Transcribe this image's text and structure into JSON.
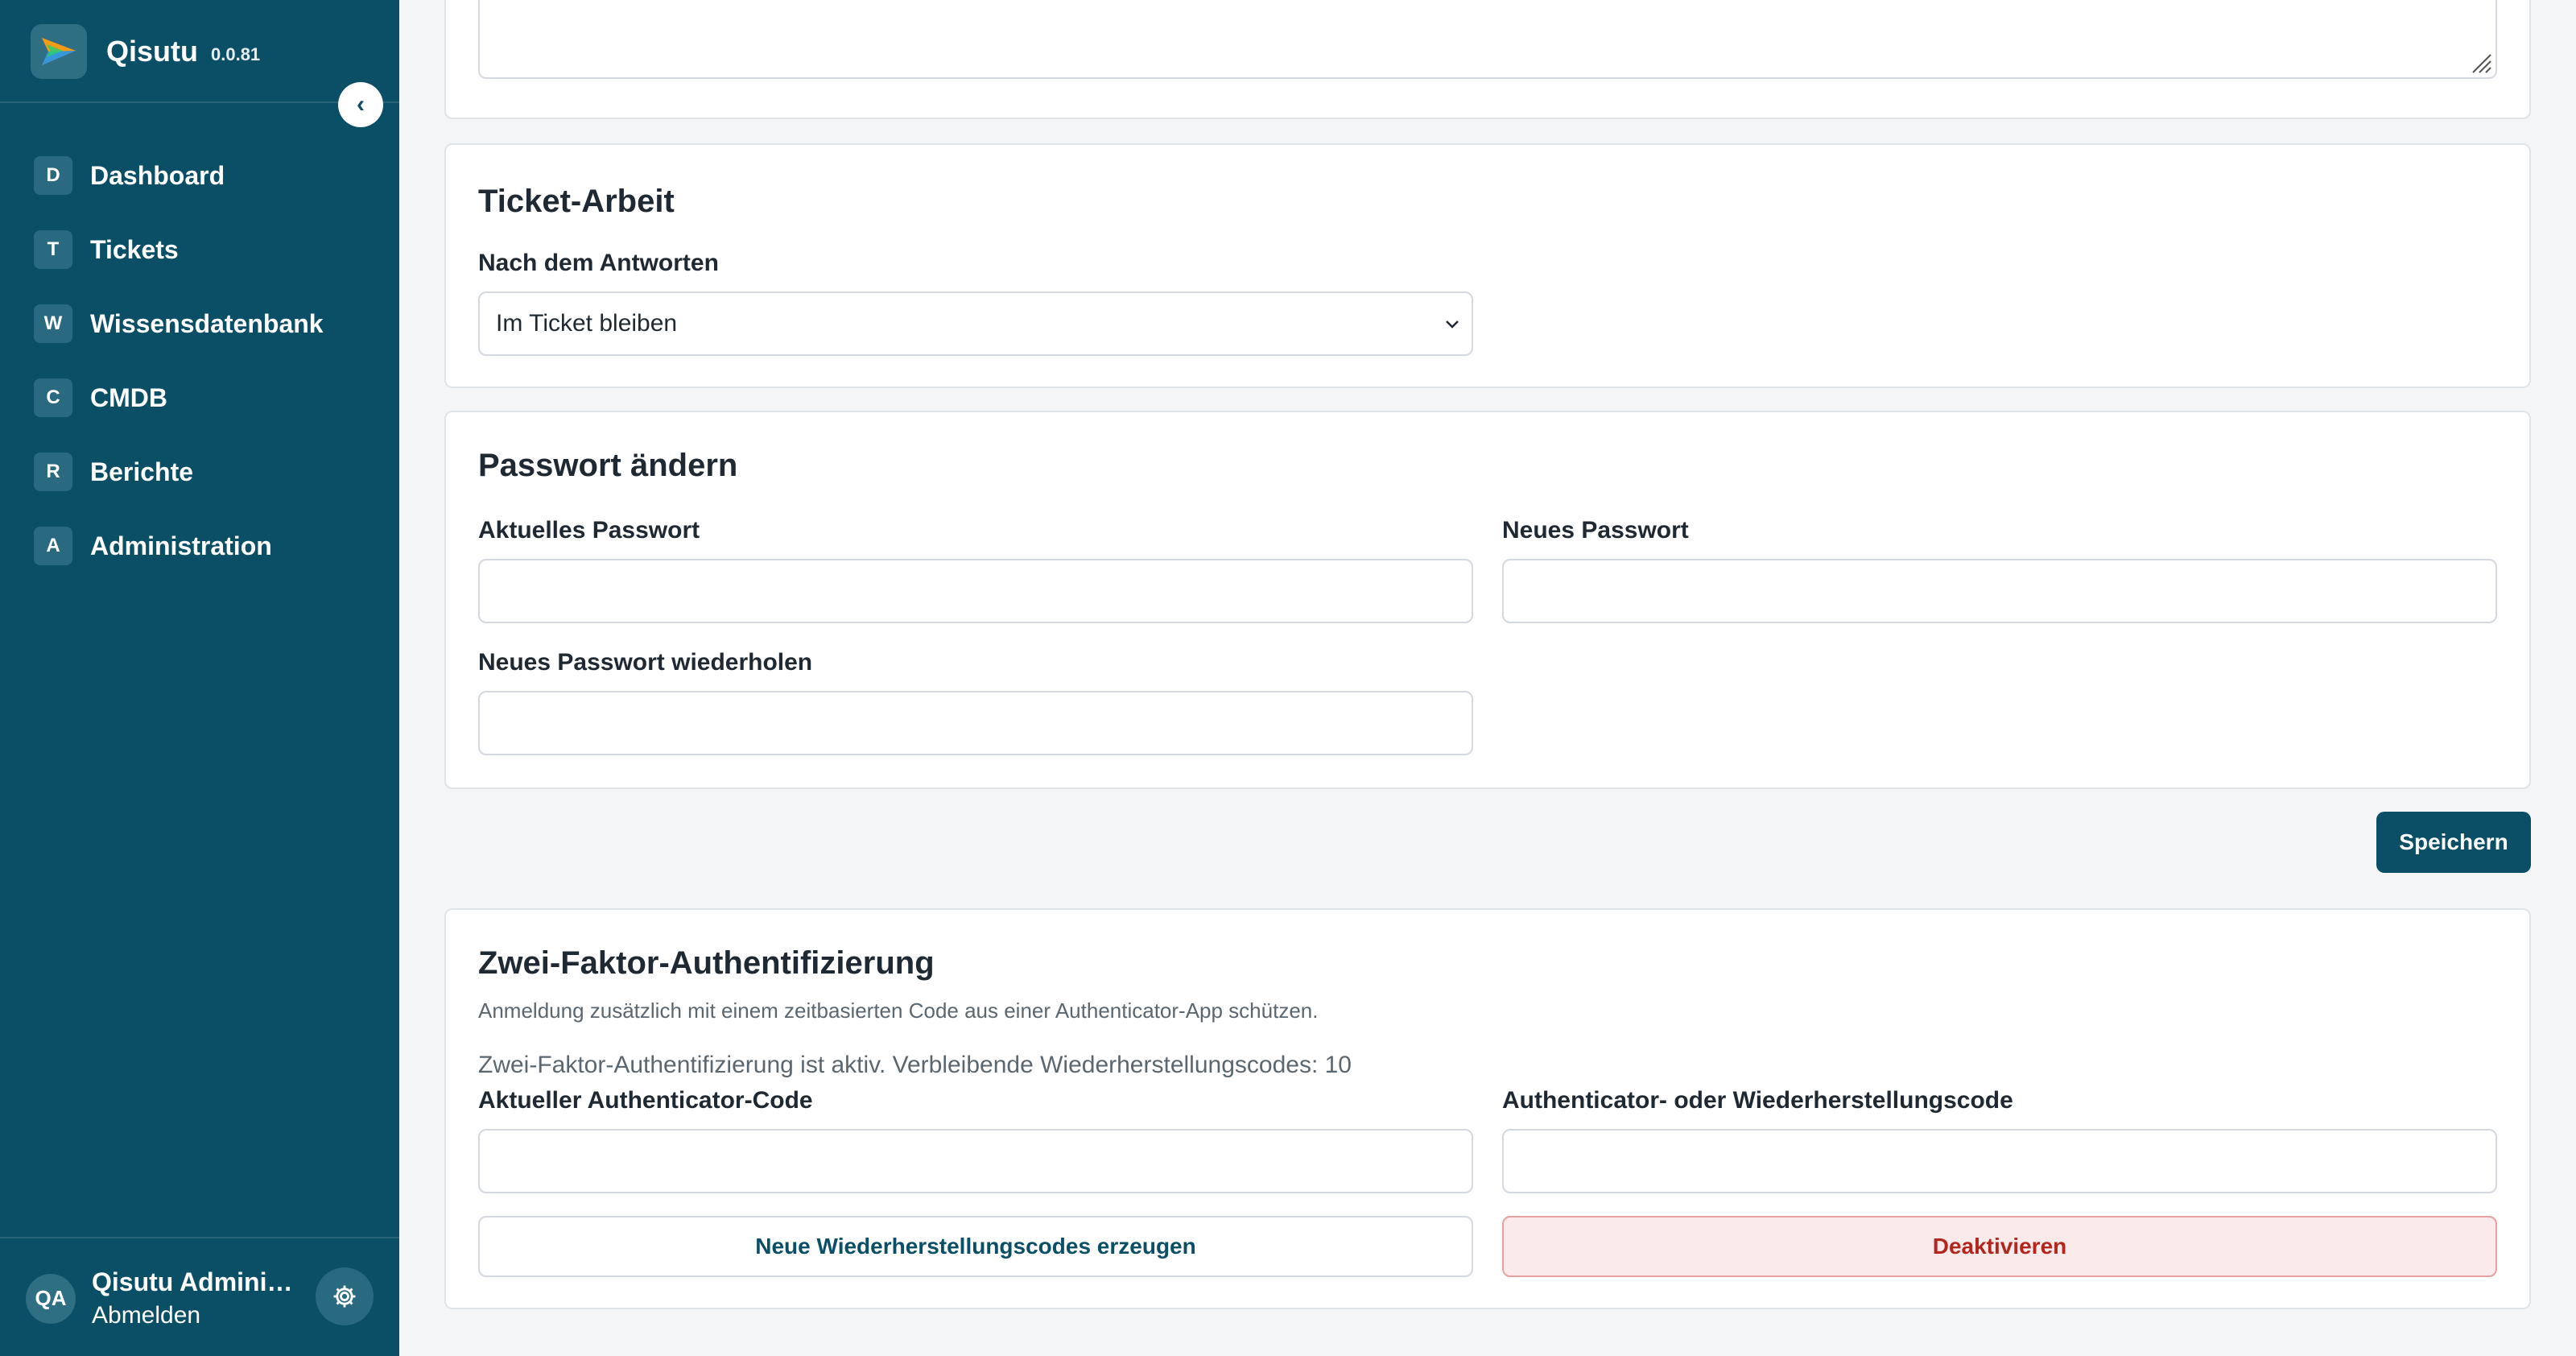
{
  "sidebar": {
    "brand": {
      "name": "Qisutu",
      "version": "0.0.81"
    },
    "collapse_glyph": "‹",
    "items": [
      {
        "letter": "D",
        "label": "Dashboard"
      },
      {
        "letter": "T",
        "label": "Tickets"
      },
      {
        "letter": "W",
        "label": "Wissensdatenbank"
      },
      {
        "letter": "C",
        "label": "CMDB"
      },
      {
        "letter": "R",
        "label": "Berichte"
      },
      {
        "letter": "A",
        "label": "Administration"
      }
    ],
    "user": {
      "initials": "QA",
      "name": "Qisutu Adminis…",
      "logout_label": "Abmelden"
    }
  },
  "ticket_work": {
    "title": "Ticket-Arbeit",
    "after_reply_label": "Nach dem Antworten",
    "after_reply_value": "Im Ticket bleiben"
  },
  "password": {
    "title": "Passwort ändern",
    "current_label": "Aktuelles Passwort",
    "new_label": "Neues Passwort",
    "repeat_label": "Neues Passwort wiederholen"
  },
  "save_label": "Speichern",
  "two_factor": {
    "title": "Zwei-Faktor-Authentifizierung",
    "description": "Anmeldung zusätzlich mit einem zeitbasierten Code aus einer Authenticator-App schützen.",
    "status": "Zwei-Faktor-Authentifizierung ist aktiv. Verbleibende Wiederherstellungscodes: 10",
    "current_code_label": "Aktueller Authenticator-Code",
    "recovery_code_label": "Authenticator- oder Wiederherstellungscode",
    "regenerate_label": "Neue Wiederherstellungscodes erzeugen",
    "deactivate_label": "Deaktivieren"
  },
  "colors": {
    "sidebar_bg": "#0b4f66",
    "primary": "#0b4f66",
    "danger_text": "#b3261e",
    "danger_bg": "#fbeaea"
  },
  "icons": {
    "brand": "paper-plane-logo-icon",
    "collapse": "chevron-left-icon",
    "settings": "gear-icon",
    "select": "chevron-down-icon",
    "resize": "resize-grip-icon"
  }
}
